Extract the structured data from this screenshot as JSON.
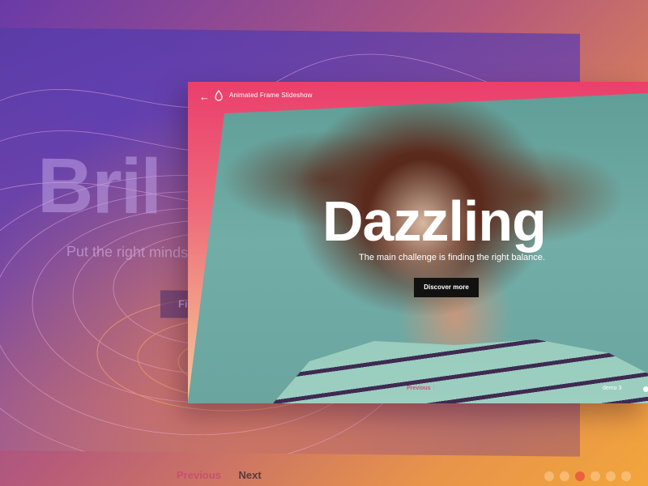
{
  "background_slide": {
    "title": "Bril",
    "subtitle": "Put the right minds",
    "button_label": "Fi"
  },
  "bottom_nav": {
    "previous_label": "Previous",
    "next_label": "Next",
    "dot_count": 6,
    "active_dot": 3
  },
  "window": {
    "title": "Animated Frame Slideshow",
    "back_icon": "arrow-left-icon",
    "logo_icon": "drop-icon",
    "slide": {
      "title": "Dazzling",
      "subtitle": "The main challenge is finding the right balance.",
      "button_label": "Discover more"
    },
    "nav": {
      "previous_label": "Previous",
      "separator": "/"
    },
    "demo_label": "demo 3"
  },
  "colors": {
    "accent": "#ea3f6c",
    "active_dot": "#e8623c",
    "button_bg": "#111111"
  }
}
